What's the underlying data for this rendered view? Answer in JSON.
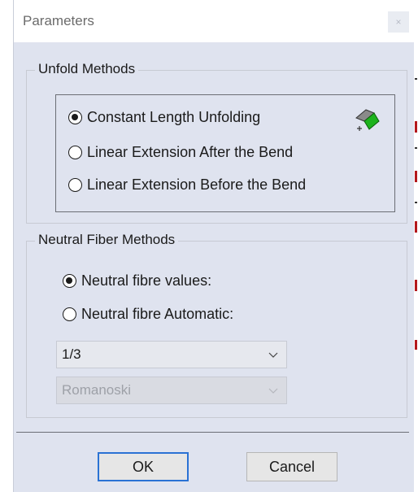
{
  "dialog": {
    "title": "Parameters",
    "close_label": "×"
  },
  "unfold_methods": {
    "title": "Unfold Methods",
    "options": [
      {
        "label": "Constant Length Unfolding",
        "checked": true
      },
      {
        "label": "Linear Extension After the Bend",
        "checked": false
      },
      {
        "label": "Linear Extension Before the Bend",
        "checked": false
      }
    ],
    "icon": "unfold-constant-length-icon"
  },
  "neutral_fiber": {
    "title": "Neutral Fiber Methods",
    "options": [
      {
        "label": "Neutral fibre values:",
        "checked": true
      },
      {
        "label": "Neutral fibre Automatic:",
        "checked": false
      }
    ],
    "value_combo": "1/3",
    "auto_combo": "Romanoski"
  },
  "buttons": {
    "ok": "OK",
    "cancel": "Cancel"
  },
  "colors": {
    "background": "#dfe3ef",
    "focus_border": "#2a72d4",
    "icon_green": "#1db31d"
  }
}
